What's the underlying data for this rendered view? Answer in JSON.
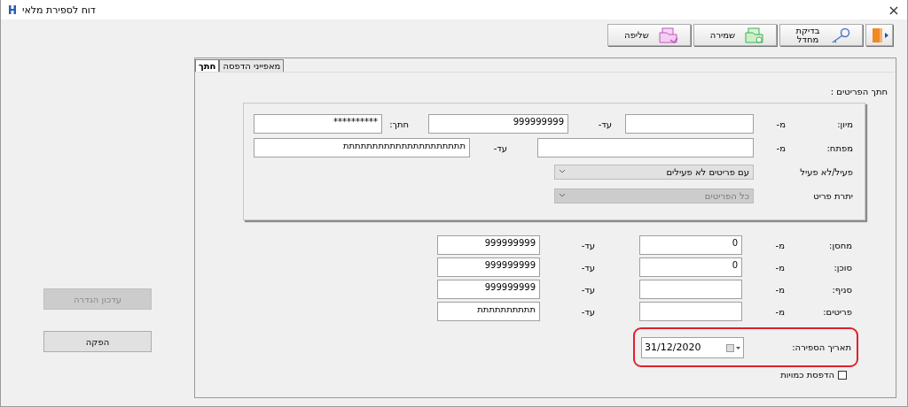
{
  "window": {
    "title": "דוח לספירת מלאי",
    "close": "×"
  },
  "toolbar": [
    {
      "kind": "exit"
    },
    {
      "kind": "key",
      "label": "בדיקת מחדל"
    },
    {
      "kind": "save",
      "label": "שמירה"
    },
    {
      "kind": "load",
      "label": "שליפה"
    }
  ],
  "side_buttons": [
    {
      "label": "עדכון הגדרה",
      "disabled": true
    },
    {
      "label": "הפקה",
      "disabled": false
    }
  ],
  "tabs": [
    {
      "label": "מאפייני הדפסה",
      "selected": false
    },
    {
      "label": "חתך",
      "selected": true
    }
  ],
  "section_label": "חתך הפריטים :",
  "group_rows": [
    {
      "cells": [
        {
          "kind": "label",
          "text": "מיון:"
        },
        {
          "kind": "label",
          "text": "מ-"
        },
        {
          "kind": "field"
        },
        {
          "kind": "label",
          "text": "עד-"
        },
        {
          "kind": "field",
          "value": "999999999"
        },
        {
          "kind": "label",
          "text": "חתך:"
        },
        {
          "kind": "field",
          "value": "**********"
        }
      ]
    },
    {
      "cells": [
        {
          "kind": "label",
          "text": "מפתח:"
        },
        {
          "kind": "label",
          "text": "מ-"
        },
        {
          "kind": "field"
        },
        {
          "kind": "label",
          "text": "עד-"
        },
        {
          "kind": "field",
          "value": "תתתתתתתתתתתתתתתתתתתתת"
        }
      ]
    },
    {
      "cells": [
        {
          "kind": "label",
          "text": "פעיל/לא פעיל"
        },
        {
          "kind": "combo",
          "value": "עם פריטים לא פעילים",
          "disabled": false
        }
      ]
    },
    {
      "cells": [
        {
          "kind": "label",
          "text": "יתרת פריט"
        },
        {
          "kind": "combo",
          "value": "כל הפריטים",
          "disabled": true
        }
      ]
    }
  ],
  "range_rows": [
    {
      "label": "מחסן:",
      "from_label": "מ-",
      "from": "0",
      "to_label": "עד-",
      "to": "999999999"
    },
    {
      "label": "סוכן:",
      "from_label": "מ-",
      "from": "0",
      "to_label": "עד-",
      "to": "999999999"
    },
    {
      "label": "סניף:",
      "from_label": "מ-",
      "to_label": "עד-",
      "to": "999999999"
    },
    {
      "label": "פריטים:",
      "from_label": "מ-",
      "to_label": "עד-",
      "to": "תתתתתתתתתת"
    }
  ],
  "count_date": {
    "label": "תאריך הספירה:",
    "value": "31/12/2020"
  },
  "print_quantities": {
    "label": "הדפסת כמויות",
    "checked": false
  }
}
